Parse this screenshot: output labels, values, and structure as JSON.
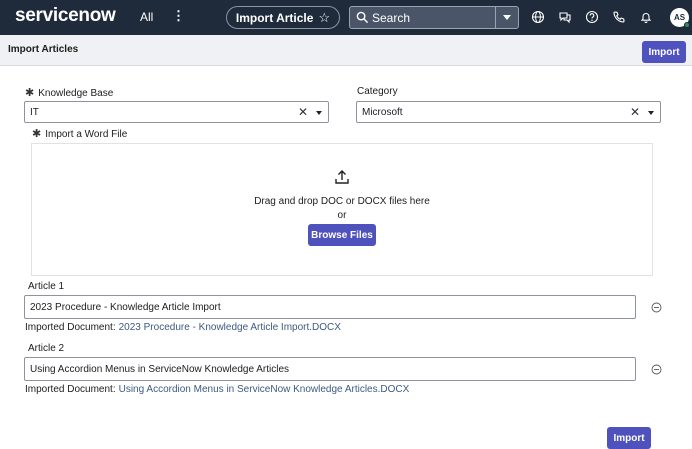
{
  "nav": {
    "logo": "servicenow",
    "all_label": "All",
    "more_label": "⋮",
    "context_title": "Import Article",
    "search_placeholder": "Search",
    "avatar_initials": "AS"
  },
  "header": {
    "title": "Import Articles",
    "import_label": "Import"
  },
  "form": {
    "knowledge_base": {
      "label": "Knowledge Base",
      "value": "IT"
    },
    "category": {
      "label": "Category",
      "value": "Microsoft"
    },
    "word_file": {
      "label": "Import a Word File",
      "drop_text": "Drag and drop DOC or DOCX files here",
      "or_text": "or",
      "browse_label": "Browse Files"
    },
    "required_marker": "✱",
    "clear_symbol": "✕",
    "articles": [
      {
        "label": "Article 1",
        "title": "2023 Procedure - Knowledge Article Import",
        "imported_label": "Imported Document:",
        "imported_file": "2023 Procedure - Knowledge Article Import.DOCX"
      },
      {
        "label": "Article 2",
        "title": "Using Accordion Menus in ServiceNow Knowledge Articles",
        "imported_label": "Imported Document:",
        "imported_file": "Using Accordion Menus in ServiceNow Knowledge Articles.DOCX"
      }
    ],
    "import_label": "Import"
  },
  "colors": {
    "nav_bg": "#1f2b3a",
    "primary_button": "#4f52bd",
    "header_bg": "#eff1f4",
    "link": "#3d5a80"
  },
  "icons": {
    "search": "search-icon",
    "favorite": "star-icon",
    "globe": "globe-icon",
    "chat": "chat-icon",
    "help": "help-icon",
    "phone": "phone-icon",
    "notifications": "bell-icon",
    "upload": "upload-icon",
    "remove": "minus-circle-icon"
  }
}
